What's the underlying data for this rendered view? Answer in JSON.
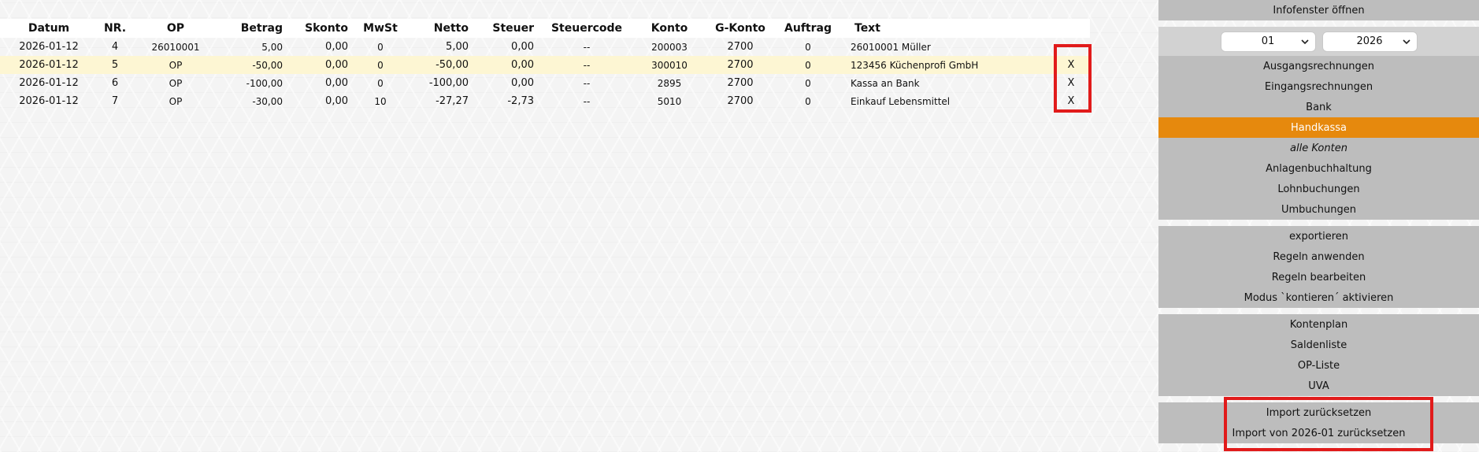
{
  "table": {
    "columns": [
      "Datum",
      "NR.",
      "OP",
      "Betrag",
      "Skonto",
      "MwSt",
      "Netto",
      "Steuer",
      "Steuercode",
      "Konto",
      "G-Konto",
      "Auftrag",
      "Text"
    ],
    "rows": [
      {
        "datum": "2026-01-12",
        "nr": "4",
        "op": "26010001",
        "betrag": "5,00",
        "skonto": "0,00",
        "mwst": "0",
        "netto": "5,00",
        "steuer": "0,00",
        "steuercode": "--",
        "konto": "200003",
        "gkonto": "2700",
        "auftrag": "0",
        "text": "26010001 Müller",
        "delete": ""
      },
      {
        "datum": "2026-01-12",
        "nr": "5",
        "op": "OP",
        "betrag": "-50,00",
        "skonto": "0,00",
        "mwst": "0",
        "netto": "-50,00",
        "steuer": "0,00",
        "steuercode": "--",
        "konto": "300010",
        "gkonto": "2700",
        "auftrag": "0",
        "text": "123456 Küchenprofi GmbH",
        "delete": "X"
      },
      {
        "datum": "2026-01-12",
        "nr": "6",
        "op": "OP",
        "betrag": "-100,00",
        "skonto": "0,00",
        "mwst": "0",
        "netto": "-100,00",
        "steuer": "0,00",
        "steuercode": "--",
        "konto": "2895",
        "gkonto": "2700",
        "auftrag": "0",
        "text": "Kassa an Bank",
        "delete": "X"
      },
      {
        "datum": "2026-01-12",
        "nr": "7",
        "op": "OP",
        "betrag": "-30,00",
        "skonto": "0,00",
        "mwst": "10",
        "netto": "-27,27",
        "steuer": "-2,73",
        "steuercode": "--",
        "konto": "5010",
        "gkonto": "2700",
        "auftrag": "0",
        "text": "Einkauf Lebensmittel",
        "delete": "X"
      }
    ]
  },
  "sidebar": {
    "info_button": "Infofenster öffnen",
    "month_select": "01",
    "year_select": "2026",
    "nav": [
      "Ausgangsrechnungen",
      "Eingangsrechnungen",
      "Bank",
      "Handkassa",
      "alle Konten",
      "Anlagenbuchhaltung",
      "Lohnbuchungen",
      "Umbuchungen"
    ],
    "nav_active": "Handkassa",
    "actions": [
      "exportieren",
      "Regeln anwenden",
      "Regeln bearbeiten",
      "Modus `kontieren´ aktivieren"
    ],
    "reports": [
      "Kontenplan",
      "Saldenliste",
      "OP-Liste",
      "UVA"
    ],
    "import": [
      "Import zurücksetzen",
      "Import von 2026-01 zurücksetzen"
    ]
  },
  "colors": {
    "accent": "#e6890d",
    "highlight_row": "#fdf6d3",
    "sidebar_bg": "#bdbdbd",
    "annotation_red": "#e11b1b"
  },
  "icons": {
    "select_arrow": "chevron-down-icon"
  }
}
